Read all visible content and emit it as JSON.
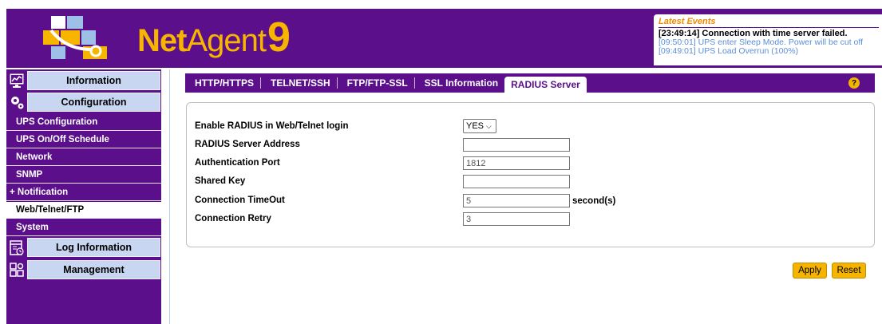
{
  "header": {
    "brand_net": "Net",
    "brand_agent": "Agent",
    "brand_version": "9"
  },
  "events": {
    "title": "Latest Events",
    "lines": [
      "[23:49:14] Connection with time server failed.",
      "[09:50:01] UPS enter Sleep Mode. Power will be cut off",
      "[09:49:01] UPS Load Overrun (100%)"
    ]
  },
  "sidebar": {
    "main": [
      {
        "label": "Information",
        "icon": "monitor-chart-icon"
      },
      {
        "label": "Configuration",
        "icon": "gears-icon"
      },
      {
        "label": "Log Information",
        "icon": "calendar-clock-icon"
      },
      {
        "label": "Management",
        "icon": "grid-gear-icon"
      }
    ],
    "sub": [
      "UPS Configuration",
      "UPS On/Off Schedule",
      "Network",
      "SNMP",
      "+ Notification",
      "Web/Telnet/FTP",
      "System"
    ]
  },
  "tabs": [
    "HTTP/HTTPS",
    "TELNET/SSH",
    "FTP/FTP-SSL",
    "SSL Information",
    "RADIUS Server"
  ],
  "help_label": "?",
  "form": {
    "enable_label": "Enable RADIUS in Web/Telnet login",
    "enable_value": "YES",
    "address_label": "RADIUS Server Address",
    "address_value": "",
    "port_label": "Authentication Port",
    "port_value": "1812",
    "key_label": "Shared Key",
    "key_value": "",
    "timeout_label": "Connection TimeOut",
    "timeout_value": "5",
    "timeout_unit": "second(s)",
    "retry_label": "Connection Retry",
    "retry_value": "3"
  },
  "buttons": {
    "apply": "Apply",
    "reset": "Reset"
  },
  "colors": {
    "brand_purple": "#5b0f8b",
    "accent_gold": "#f5b400",
    "nav_blue": "#c8d6f1"
  }
}
